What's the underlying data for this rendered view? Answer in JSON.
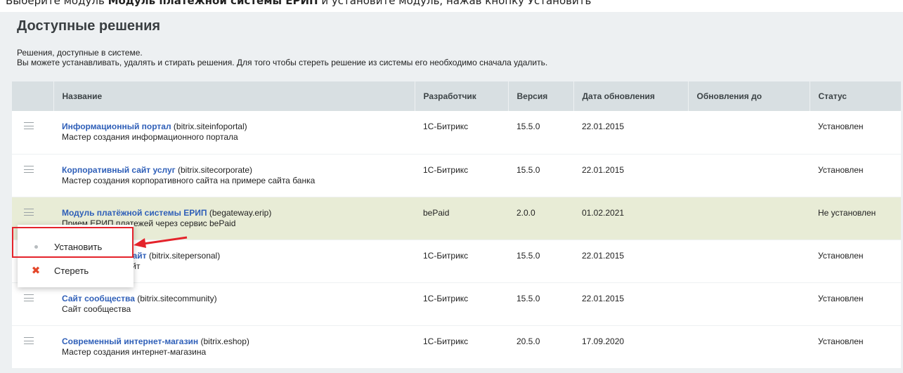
{
  "instruction": {
    "prefix": "Выберите модуль ",
    "bold": "Модуль платёжной системы ЕРИП",
    "suffix": " и установите модуль, нажав кнопку Установить"
  },
  "page": {
    "title": "Доступные решения",
    "desc_line1": "Решения, доступные в системе.",
    "desc_line2": "Вы можете устанавливать, удалять и стирать решения. Для того чтобы стереть решение из системы его необходимо сначала удалить."
  },
  "table": {
    "headers": {
      "name": "Название",
      "developer": "Разработчик",
      "version": "Версия",
      "updated": "Дата обновления",
      "updates_until": "Обновления до",
      "status": "Статус"
    },
    "rows": [
      {
        "name": "Информационный портал",
        "code": " (bitrix.siteinfoportal)",
        "desc": "Мастер создания информационного портала",
        "developer": "1С-Битрикс",
        "version": "15.5.0",
        "updated": "22.01.2015",
        "updates_until": "",
        "status": "Установлен"
      },
      {
        "name": "Корпоративный сайт услуг",
        "code": " (bitrix.sitecorporate)",
        "desc": "Мастер создания корпоративного сайта на примере сайта банка",
        "developer": "1С-Битрикс",
        "version": "15.5.0",
        "updated": "22.01.2015",
        "updates_until": "",
        "status": "Установлен"
      },
      {
        "name": "Модуль платёжной системы ЕРИП",
        "code": " (begateway.erip)",
        "desc": "Прием ЕРИП платежей через сервис bePaid",
        "developer": "bePaid",
        "version": "2.0.0",
        "updated": "01.02.2021",
        "updates_until": "",
        "status": "Не установлен"
      },
      {
        "name": "Персональный сайт",
        "code": " (bitrix.sitepersonal)",
        "desc": "Персональный сайт",
        "developer": "1С-Битрикс",
        "version": "15.5.0",
        "updated": "22.01.2015",
        "updates_until": "",
        "status": "Установлен"
      },
      {
        "name": "Сайт сообщества",
        "code": " (bitrix.sitecommunity)",
        "desc": "Сайт сообщества",
        "developer": "1С-Битрикс",
        "version": "15.5.0",
        "updated": "22.01.2015",
        "updates_until": "",
        "status": "Установлен"
      },
      {
        "name": "Современный интернет-магазин",
        "code": " (bitrix.eshop)",
        "desc": "Мастер создания интернет-магазина",
        "developer": "1С-Битрикс",
        "version": "20.5.0",
        "updated": "17.09.2020",
        "updates_until": "",
        "status": "Установлен"
      }
    ]
  },
  "context_menu": {
    "install": "Установить",
    "erase": "Стереть"
  },
  "colors": {
    "link": "#2f5fb8",
    "developer": "#a180b3",
    "not_installed": "#e4232b",
    "highlight_row": "#e8ecd6",
    "annotation": "#e4232b"
  }
}
